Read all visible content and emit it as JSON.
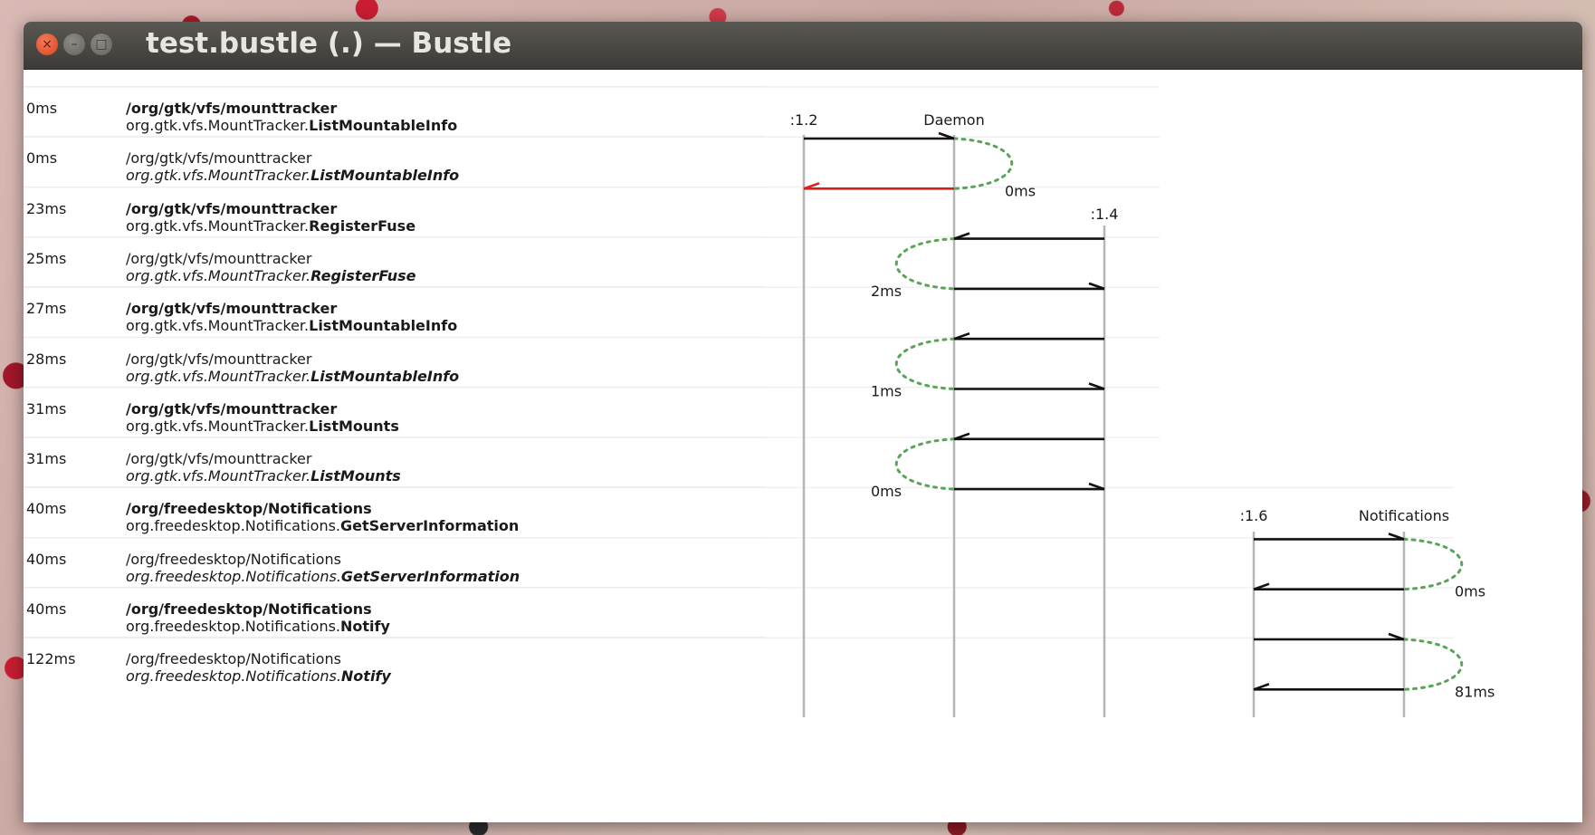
{
  "window": {
    "title": "test.bustle (.) — Bustle"
  },
  "title_buttons": {
    "close_glyph": "×",
    "minimize_glyph": "–",
    "maximize_glyph": "□"
  },
  "rows": [
    {
      "time": "0ms",
      "path": "/org/gtk/vfs/mounttracker",
      "interface": "org.gtk.vfs.MountTracker.",
      "method": "ListMountableInfo",
      "kind": "call"
    },
    {
      "time": "0ms",
      "path": "/org/gtk/vfs/mounttracker",
      "interface": "org.gtk.vfs.MountTracker.",
      "method": "ListMountableInfo",
      "kind": "return"
    },
    {
      "time": "23ms",
      "path": "/org/gtk/vfs/mounttracker",
      "interface": "org.gtk.vfs.MountTracker.",
      "method": "RegisterFuse",
      "kind": "call"
    },
    {
      "time": "25ms",
      "path": "/org/gtk/vfs/mounttracker",
      "interface": "org.gtk.vfs.MountTracker.",
      "method": "RegisterFuse",
      "kind": "return"
    },
    {
      "time": "27ms",
      "path": "/org/gtk/vfs/mounttracker",
      "interface": "org.gtk.vfs.MountTracker.",
      "method": "ListMountableInfo",
      "kind": "call"
    },
    {
      "time": "28ms",
      "path": "/org/gtk/vfs/mounttracker",
      "interface": "org.gtk.vfs.MountTracker.",
      "method": "ListMountableInfo",
      "kind": "return"
    },
    {
      "time": "31ms",
      "path": "/org/gtk/vfs/mounttracker",
      "interface": "org.gtk.vfs.MountTracker.",
      "method": "ListMounts",
      "kind": "call"
    },
    {
      "time": "31ms",
      "path": "/org/gtk/vfs/mounttracker",
      "interface": "org.gtk.vfs.MountTracker.",
      "method": "ListMounts",
      "kind": "return"
    },
    {
      "time": "40ms",
      "path": "/org/freedesktop/Notifications",
      "interface": "org.freedesktop.Notifications.",
      "method": "GetServerInformation",
      "kind": "call"
    },
    {
      "time": "40ms",
      "path": "/org/freedesktop/Notifications",
      "interface": "org.freedesktop.Notifications.",
      "method": "GetServerInformation",
      "kind": "return"
    },
    {
      "time": "40ms",
      "path": "/org/freedesktop/Notifications",
      "interface": "org.freedesktop.Notifications.",
      "method": "Notify",
      "kind": "call"
    },
    {
      "time": "122ms",
      "path": "/org/freedesktop/Notifications",
      "interface": "org.freedesktop.Notifications.",
      "method": "Notify",
      "kind": "return"
    }
  ],
  "lifeline_labels": {
    "a": ":1.2",
    "b": "Daemon",
    "c": ":1.4",
    "d": ":1.6",
    "e": "Notifications"
  },
  "durations": [
    "0ms",
    "2ms",
    "1ms",
    "0ms",
    "0ms",
    "81ms"
  ],
  "colors": {
    "error_return": "#d8201a",
    "duration_curve": "#5aa45a"
  }
}
